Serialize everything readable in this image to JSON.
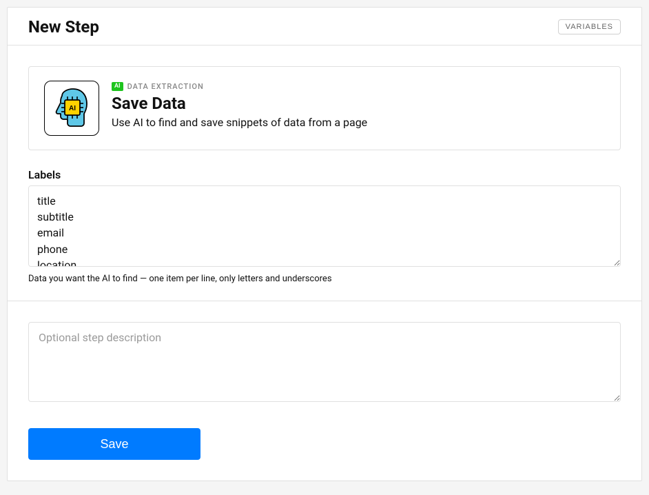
{
  "header": {
    "title": "New Step",
    "variables_btn": "VARIABLES"
  },
  "card": {
    "ai_badge": "AI",
    "category": "DATA EXTRACTION",
    "title": "Save Data",
    "description": "Use AI to find and save snippets of data from a page"
  },
  "labels_field": {
    "label": "Labels",
    "value": "title\nsubtitle\nemail\nphone\nlocation",
    "helper": "Data you want the AI to find — one item per line, only letters and underscores"
  },
  "description_field": {
    "placeholder": "Optional step description",
    "value": ""
  },
  "save_btn": "Save"
}
